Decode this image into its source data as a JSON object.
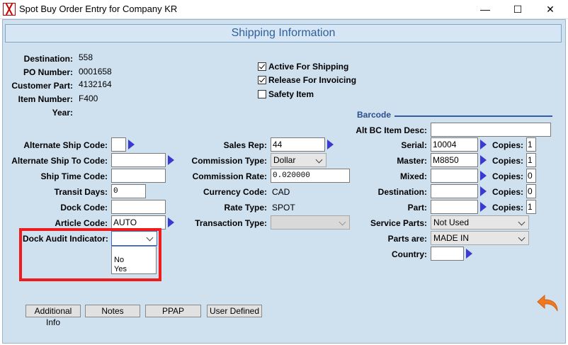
{
  "window": {
    "title": "Spot Buy Order Entry for Company KR",
    "minimize": "—",
    "maximize": "☐",
    "close": "✕"
  },
  "header": {
    "title": "Shipping Information"
  },
  "info": {
    "destination_label": "Destination:",
    "destination": "558",
    "po_label": "PO Number:",
    "po": "0001658",
    "customer_part_label": "Customer Part:",
    "customer_part": "4132164",
    "item_number_label": "Item Number:",
    "item_number": "F400",
    "year_label": "Year:",
    "year": ""
  },
  "checkboxes": [
    {
      "label": "Active For Shipping",
      "checked": true
    },
    {
      "label": "Release For Invoicing",
      "checked": true
    },
    {
      "label": "Safety Item",
      "checked": false
    }
  ],
  "left_fields": {
    "alt_ship_code_label": "Alternate Ship Code:",
    "alt_ship_code": "",
    "alt_ship_to_label": "Alternate Ship To Code:",
    "alt_ship_to": "",
    "ship_time_label": "Ship Time Code:",
    "ship_time": "",
    "transit_days_label": "Transit Days:",
    "transit_days": "0",
    "dock_code_label": "Dock Code:",
    "dock_code": "",
    "article_code_label": "Article Code:",
    "article_code": "AUTO",
    "dock_audit_label": "Dock Audit Indicator:",
    "dock_audit": "",
    "dock_audit_options": [
      "No",
      "Yes"
    ]
  },
  "mid_fields": {
    "sales_rep_label": "Sales Rep:",
    "sales_rep": "44",
    "commission_type_label": "Commission Type:",
    "commission_type": "Dollar",
    "commission_rate_label": "Commission Rate:",
    "commission_rate": "0.020000",
    "currency_label": "Currency Code:",
    "currency": "CAD",
    "rate_type_label": "Rate Type:",
    "rate_type": "SPOT",
    "transaction_type_label": "Transaction Type:",
    "transaction_type": ""
  },
  "barcode": {
    "title": "Barcode",
    "alt_bc_label": "Alt BC Item Desc:",
    "alt_bc": "",
    "serial_label": "Serial:",
    "serial": "10004",
    "serial_copies": "1",
    "master_label": "Master:",
    "master": "M8850",
    "master_copies": "1",
    "mixed_label": "Mixed:",
    "mixed": "",
    "mixed_copies": "0",
    "destination_label": "Destination:",
    "destination": "",
    "destination_copies": "0",
    "part_label": "Part:",
    "part": "",
    "part_copies": "1",
    "copies_label": "Copies:",
    "service_parts_label": "Service Parts:",
    "service_parts": "Not Used",
    "parts_are_label": "Parts are:",
    "parts_are": "MADE IN",
    "country_label": "Country:",
    "country": ""
  },
  "buttons": {
    "additional_info": "Additional Info",
    "notes": "Notes",
    "ppap": "PPAP",
    "user_defined": "User Defined"
  },
  "colors": {
    "accent_arrow": "#3a3ad0",
    "highlight": "#ee1c1c",
    "undo": "#f07820"
  }
}
